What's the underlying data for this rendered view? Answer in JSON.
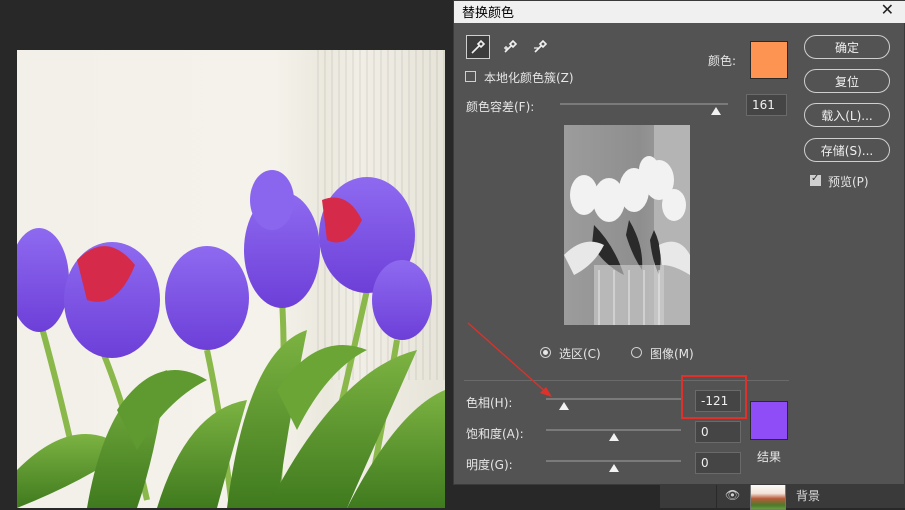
{
  "dialog": {
    "title": "替换颜色",
    "close_glyph": "✕",
    "localized_clusters_label": "本地化颜色簇(Z)",
    "color_label": "颜色:",
    "color_swatch": "#fd9451",
    "fuzziness_label": "颜色容差(F):",
    "fuzziness_value": "161",
    "fuzziness_fraction": 0.93,
    "selection_label": "选区(C)",
    "image_label": "图像(M)",
    "selection_mode": "选区",
    "hue_label": "色相(H):",
    "hue_value": "-121",
    "hue_fraction": 0.13,
    "saturation_label": "饱和度(A):",
    "saturation_value": "0",
    "saturation_fraction": 0.5,
    "lightness_label": "明度(G):",
    "lightness_value": "0",
    "lightness_fraction": 0.5,
    "result_label": "结果",
    "result_swatch": "#8e4df7",
    "buttons": {
      "ok": "确定",
      "reset": "复位",
      "load": "载入(L)...",
      "save": "存储(S)..."
    },
    "preview_label": "预览(P)",
    "preview_checked": true,
    "eyedropper_tools": [
      "eyedropper-icon",
      "eyedropper-plus-icon",
      "eyedropper-minus-icon"
    ]
  },
  "layers": {
    "background_layer_name": "背景",
    "eye_glyph": "👁"
  },
  "colors": {
    "annotation_red": "#e0302a",
    "tulip_purple": "#7b52e8",
    "tulip_red": "#d62a4a"
  }
}
